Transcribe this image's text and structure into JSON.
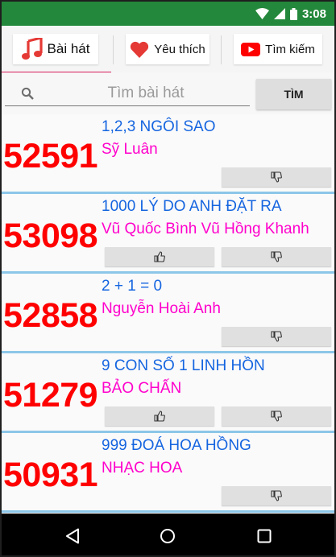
{
  "status_bar": {
    "time": "3:08",
    "icons": [
      "wifi-icon",
      "signal-icon",
      "battery-icon"
    ]
  },
  "tabs": [
    {
      "label": "Bài hát",
      "icon": "music-note-icon",
      "selected": true
    },
    {
      "label": "Yêu thích",
      "icon": "heart-icon",
      "selected": false
    },
    {
      "label": "Tìm kiếm",
      "icon": "youtube-icon",
      "selected": false
    }
  ],
  "search": {
    "placeholder": "Tìm bài hát",
    "value": "",
    "button_label": "TÌM"
  },
  "songs": [
    {
      "number": "52591",
      "title": "1,2,3 NGÔI SAO",
      "artist": "Sỹ Luân",
      "like_button": false
    },
    {
      "number": "53098",
      "title": "1000 LÝ DO ANH ĐẶT RA",
      "artist": "Vũ Quốc Bình Vũ Hồng Khanh",
      "like_button": true
    },
    {
      "number": "52858",
      "title": "2 + 1 = 0",
      "artist": "Nguyễn Hoài Anh",
      "like_button": false
    },
    {
      "number": "51279",
      "title": "9 CON SỐ 1 LINH HỒN",
      "artist": "BẢO CHẤN",
      "like_button": true
    },
    {
      "number": "50931",
      "title": "999 ĐOÁ HOA HỒNG",
      "artist": "NHẠC HOA",
      "like_button": false
    }
  ],
  "colors": {
    "status_bar": "#23883b",
    "song_number": "#ff0000",
    "song_title": "#1565e0",
    "song_artist": "#ff00cc",
    "row_divider": "#8cc6e8",
    "tab_indicator": "#d81b60"
  },
  "nav_bar": {
    "icons": [
      "back-icon",
      "home-icon",
      "recents-icon"
    ]
  }
}
